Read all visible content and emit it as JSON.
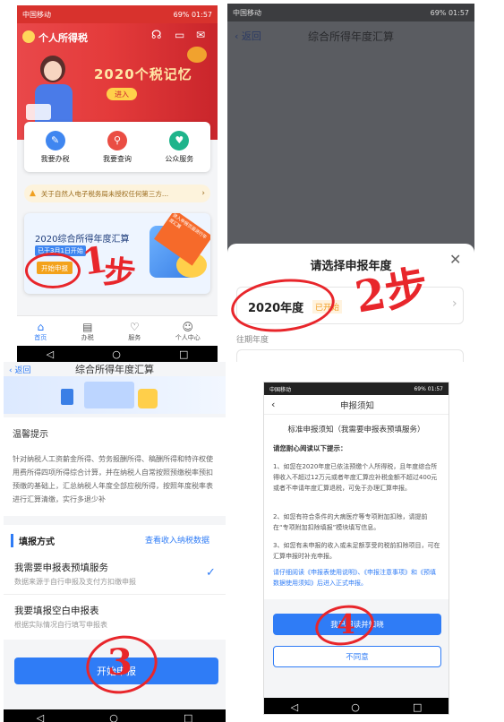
{
  "status": {
    "carrier": "中国移动",
    "battery": "69%",
    "time": "01:57"
  },
  "p1": {
    "app_title": "个人所得税",
    "banner_title": "2020个税记忆",
    "banner_btn": "进入",
    "services": [
      "我要办税",
      "我要查询",
      "公众服务"
    ],
    "notice": "关于自然人电子税务局未授权任何第三方...",
    "promo_title": "2020综合所得年度汇算",
    "promo_sub": "已于3月1日开始",
    "promo_btn": "开始申报",
    "promo_ribbon": "进入申报页面进行年度汇算",
    "tabs": [
      "首页",
      "办税",
      "服务",
      "个人中心"
    ]
  },
  "p2": {
    "back": "返回",
    "title": "综合所得年度汇算",
    "sheet_title": "请选择申报年度",
    "year": "2020年度",
    "year_badge": "已开始",
    "past": "往期年度"
  },
  "p3": {
    "back": "返回",
    "title": "综合所得年度汇算",
    "tips_title": "温馨提示",
    "tips_body": "针对纳税人工资薪金所得、劳务报酬所得、稿酬所得和特许权使用费所得四项所得综合计算，并在纳税人自常按照预缴税率预扣预缴的基础上，汇总纳税人年度全部应税所得，按照年度税率表进行汇算清缴，实行多退少补",
    "fill_title": "填报方式",
    "fill_link": "查看收入纳税数据",
    "opt1_title": "我需要申报表预填服务",
    "opt1_sub": "数据来源于自行申报及支付方扣缴申报",
    "opt2_title": "我要填报空白申报表",
    "opt2_sub": "根据实际情况自行填写申报表",
    "start_btn": "开始申报"
  },
  "p4": {
    "title": "申报须知",
    "heading": "标准申报须知（我需要申报表预填服务）",
    "lead": "请您耐心阅读以下提示：",
    "para1": "1、如您在2020年度已依法预缴个人所得税，且年度综合所得收入不超过12万元或者年度汇算应补税金额不超过400元或者不申请年度汇算退税，可免于办理汇算申报。",
    "para2": "2、如您有符合条件的大病医疗等专项附加扣除，请提前在“专项附加扣除填报”模块填写信息。",
    "para3": "3、如您有未申报的收入或未足额享受的税前扣除项目，可在汇算申报时补充申报。",
    "para4": "请仔细阅读《申报表使用说明》、《申报注意事项》和《预填数据使用须知》后进入正式申报。",
    "agree": "我已阅读并知晓",
    "disagree": "不同意"
  },
  "annotations": {
    "step2": "2步"
  }
}
